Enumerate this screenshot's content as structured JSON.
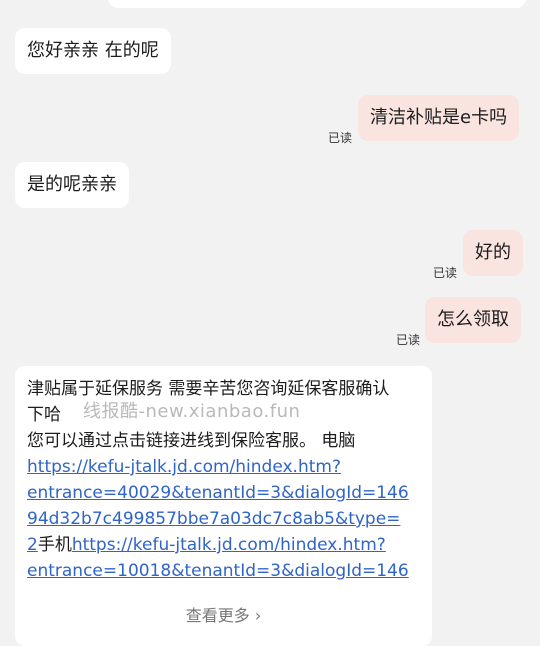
{
  "messages": [
    {
      "text": "您好亲亲  在的呢"
    },
    {
      "text": "清洁补贴是e卡吗",
      "read": "已读"
    },
    {
      "text": "是的呢亲亲"
    },
    {
      "text": "好的",
      "read": "已读"
    },
    {
      "text": "怎么领取",
      "read": "已读"
    }
  ],
  "long_message": {
    "line1": "津贴属于延保服务 需要辛苦您咨询延保客服确认",
    "line2": "下哈",
    "line3": "您可以通过点击链接进线到保险客服。 电脑",
    "link1_a": "https://kefu-jtalk.jd.com/hindex.htm?",
    "link1_b": "entrance=40029&tenantId=3&dialogId=146",
    "link1_c": "94d32b7c499857bbe7a03dc7c8ab5&type=",
    "link1_d": "2",
    "phone_label": "手机",
    "link2_a": "https://kefu-jtalk.jd.com/hindex.htm?",
    "link2_b": "entrance=10018&tenantId=3&dialogId=146",
    "show_more": "查看更多 ›"
  },
  "watermark": "线报酷-new.xianbao.fun"
}
